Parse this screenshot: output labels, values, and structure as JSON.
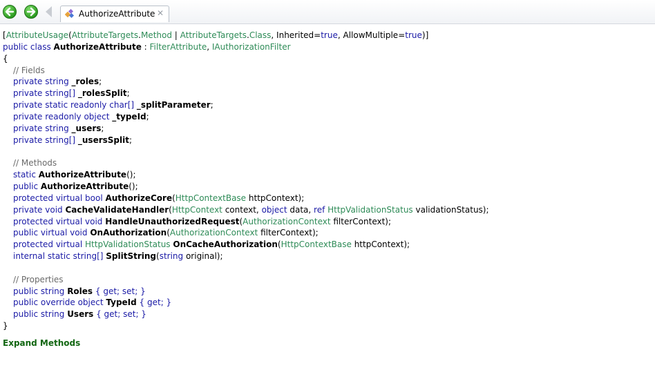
{
  "toolbar": {
    "back_icon": "back-arrow-icon",
    "forward_icon": "forward-arrow-icon",
    "tab_label": "AuthorizeAttribute",
    "tab_close": "✕"
  },
  "code": {
    "attr_open": "[",
    "attr_usage": "AttributeUsage",
    "paren_open": "(",
    "attr_targets1": "AttributeTargets",
    "method": "Method",
    "pipe": " | ",
    "attr_targets2": "AttributeTargets",
    "class_val": "Class",
    "inherited": ", Inherited=",
    "true1": "true",
    "allow_multiple": ", AllowMultiple=",
    "true2": "true",
    "attr_close": ")]",
    "public_class": "public class ",
    "class_name": "AuthorizeAttribute",
    "colon": " : ",
    "base1": "FilterAttribute",
    "comma": ", ",
    "base2": "IAuthorizationFilter",
    "brace_open": "{",
    "fields_comment": "// Fields",
    "fields": [
      {
        "mods": "private ",
        "type": "string",
        "name": "_roles"
      },
      {
        "mods": "private ",
        "type": "string[]",
        "name": "_rolesSplit"
      },
      {
        "mods": "private static readonly ",
        "type": "char[]",
        "name": "_splitParameter"
      },
      {
        "mods": "private readonly ",
        "type": "object",
        "name": "_typeId"
      },
      {
        "mods": "private ",
        "type": "string",
        "name": "_users"
      },
      {
        "mods": "private ",
        "type": "string[]",
        "name": "_usersSplit"
      }
    ],
    "methods_comment": "// Methods",
    "m1": {
      "mods": "static ",
      "name": "AuthorizeAttribute",
      "rest": "();"
    },
    "m2": {
      "mods": "public ",
      "name": "AuthorizeAttribute",
      "rest": "();"
    },
    "m3": {
      "mods": "protected virtual ",
      "ret": "bool ",
      "name": "AuthorizeCore",
      "p1t": "HttpContextBase",
      "p1n": " httpContext);"
    },
    "m4": {
      "mods": "private ",
      "ret": "void ",
      "name": "CacheValidateHandler",
      "p1t": "HttpContext",
      "p1n": " context, ",
      "p2t": "object",
      "p2n": " data, ",
      "p3k": "ref ",
      "p3t": "HttpValidationStatus",
      "p3n": " validationStatus);"
    },
    "m5": {
      "mods": "protected virtual ",
      "ret": "void ",
      "name": "HandleUnauthorizedRequest",
      "p1t": "AuthorizationContext",
      "p1n": " filterContext);"
    },
    "m6": {
      "mods": "public virtual ",
      "ret": "void ",
      "name": "OnAuthorization",
      "p1t": "AuthorizationContext",
      "p1n": " filterContext);"
    },
    "m7": {
      "mods": "protected virtual ",
      "ret": "HttpValidationStatus ",
      "name": "OnCacheAuthorization",
      "p1t": "HttpContextBase",
      "p1n": " httpContext);"
    },
    "m8": {
      "mods": "internal static ",
      "ret": "string[] ",
      "name": "SplitString",
      "p1t": "string",
      "p1n": " original);"
    },
    "props_comment": "// Properties",
    "p1": {
      "mods": "public ",
      "type": "string ",
      "name": "Roles",
      "acc": " { get; set; }"
    },
    "p2": {
      "mods": "public override ",
      "type": "object ",
      "name": "TypeId",
      "acc": " { get; }"
    },
    "p3": {
      "mods": "public ",
      "type": "string ",
      "name": "Users",
      "acc": " { get; set; }"
    },
    "brace_close": "}",
    "expand_methods": "Expand Methods"
  }
}
